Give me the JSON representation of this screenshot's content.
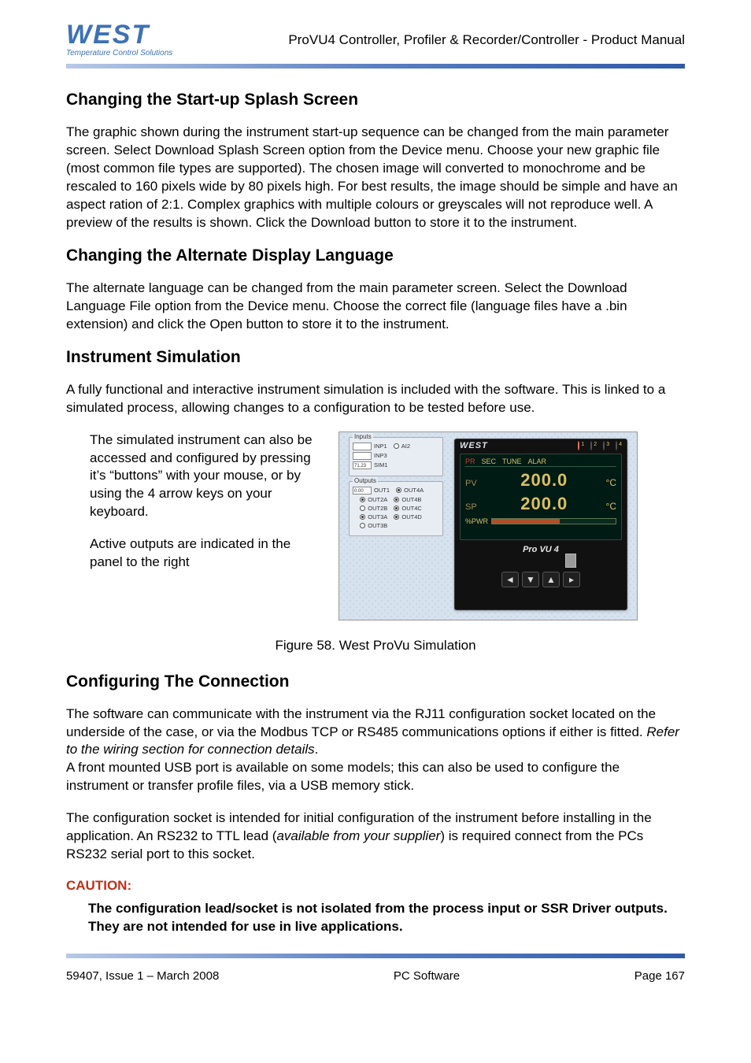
{
  "header": {
    "logo_main": "WEST",
    "logo_sub": "Temperature Control Solutions",
    "doc_title": "ProVU4 Controller, Profiler & Recorder/Controller - Product Manual"
  },
  "sections": {
    "splash": {
      "title": "Changing the Start-up Splash Screen",
      "body": "The graphic shown during the instrument start-up sequence can be changed from the main parameter screen. Select Download Splash Screen option from the Device menu. Choose your new graphic file (most common file types are supported). The chosen image will converted to monochrome and be rescaled to 160 pixels wide by 80 pixels high. For best results, the image should be simple and have an aspect ration of 2:1. Complex graphics with multiple colours or greyscales will not reproduce well. A preview of the results is shown. Click the Download button to store it to the instrument."
    },
    "language": {
      "title": "Changing the Alternate Display Language",
      "body": "The alternate language can be changed from the main parameter screen. Select the Download Language File option from the Device menu. Choose the correct file (language files have a .bin extension) and click the Open button to store it to the instrument."
    },
    "simulation": {
      "title": "Instrument Simulation",
      "intro": "A fully functional and interactive instrument simulation is included with the software. This is linked to a simulated process, allowing changes to a configuration to be tested before use.",
      "callout1": "The simulated instrument can also be accessed and configured by pressing it’s “buttons” with your mouse, or by using the 4 arrow keys on your keyboard.",
      "callout2": "Active outputs are indicated in the panel to the right",
      "io": {
        "inputs_title": "Inputs",
        "inp1": "INP1",
        "ai2": "AI2",
        "inp3": "INP3",
        "sim1_val": "71.23",
        "sim1": "SIM1",
        "outputs_title": "Outputs",
        "out1_val": "0.00",
        "out1": "OUT1",
        "out4a": "OUT4A",
        "out2a": "OUT2A",
        "out4b": "OUT4B",
        "out2b": "OUT2B",
        "out4c": "OUT4C",
        "out3a": "OUT3A",
        "out4d": "OUT4D",
        "out3b": "OUT3B"
      },
      "device": {
        "brand": "WEST",
        "led1": "1",
        "led2": "2",
        "led3": "3",
        "led4": "4",
        "tabs": {
          "pr": "PR",
          "sec": "SEC",
          "tune": "TUNE",
          "alar": "ALAR"
        },
        "pv_lbl": "PV",
        "pv_val": "200.0",
        "pv_unit": "°C",
        "sp_lbl": "SP",
        "sp_val": "200.0",
        "sp_unit": "°C",
        "pwr_lbl": "%PWR",
        "model": "Pro VU 4"
      },
      "figure": "Figure 58.      West ProVu Simulation"
    },
    "connection": {
      "title": "Configuring The Connection",
      "p1a": "The software can communicate with the instrument via the RJ11 configuration socket located on the underside of the case, or via the Modbus TCP or RS485 communications options if either is fitted. ",
      "p1b": "Refer to the wiring section for connection details",
      "p1c": ".",
      "p2": "A front mounted USB port is available on some models; this can also be used to configure the instrument or transfer profile files, via a USB memory stick.",
      "p3a": "The configuration socket is intended for initial configuration of the instrument before installing in the application. An RS232 to TTL lead (",
      "p3b": "available from your supplier",
      "p3c": ") is required connect from the PCs RS232 serial port to this socket.",
      "caution_label": "CAUTION:",
      "caution_body": "The configuration lead/socket is not isolated from the process input or SSR Driver outputs. They are not intended for use in live applications."
    }
  },
  "footer": {
    "left": "59407, Issue 1 – March 2008",
    "center": "PC Software",
    "right": "Page 167"
  }
}
